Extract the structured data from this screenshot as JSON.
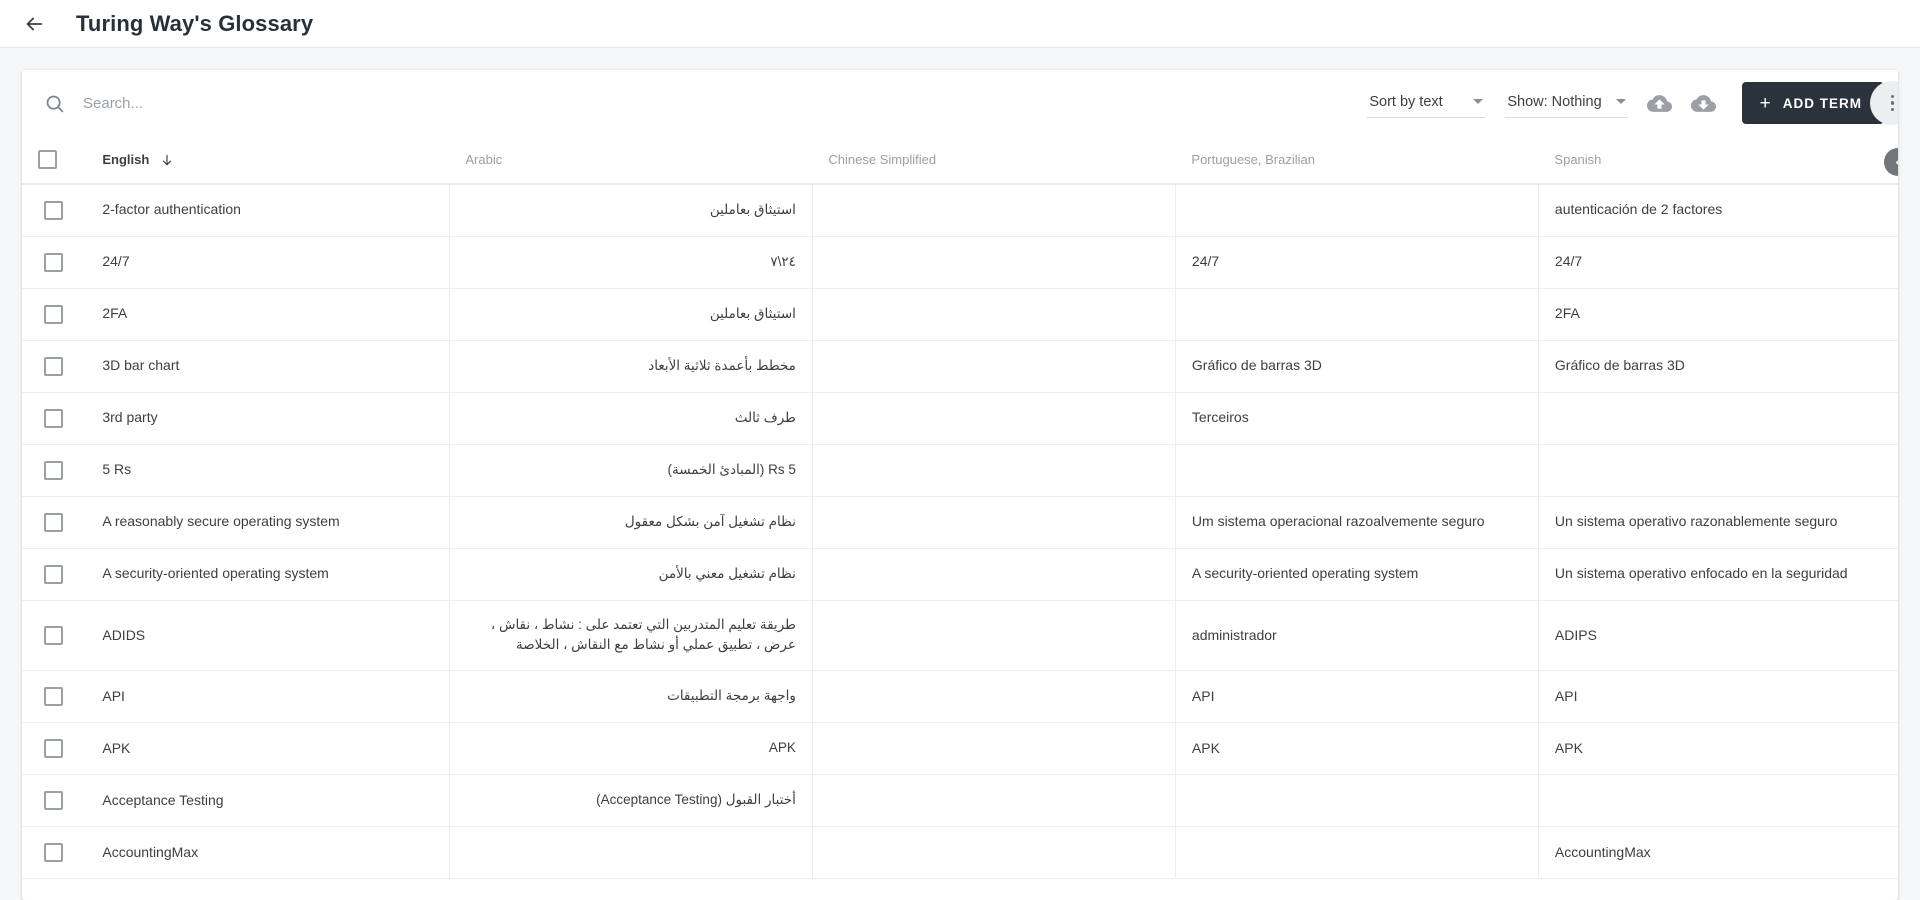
{
  "appbar": {
    "back_icon": "arrow-left-icon",
    "title": "Turing Way's Glossary"
  },
  "toolbar": {
    "search_icon": "search-icon",
    "search_value": "",
    "search_placeholder": "Search...",
    "sort_label": "Sort by text",
    "show_label": "Show: Nothing",
    "upload_icon": "cloud-upload-icon",
    "download_icon": "cloud-download-icon",
    "add_term_label": "ADD TERM",
    "add_term_plus": "+",
    "overflow_icon": "more-vertical-icon",
    "accent_color": "#2a333c"
  },
  "table": {
    "select_all_icon": "checkbox-unchecked-icon",
    "sort_icon": "arrow-down-icon",
    "sorted_column": "English",
    "columns": [
      "English",
      "Arabic",
      "Chinese Simplified",
      "Portuguese, Brazilian",
      "Spanish"
    ],
    "rows": [
      {
        "english": "2-factor authentication",
        "arabic": "استيثاق بعاملين",
        "chinese": "",
        "portuguese": "",
        "spanish": "autenticación de 2 factores"
      },
      {
        "english": "24/7",
        "arabic": "٢٤\\٧",
        "chinese": "",
        "portuguese": "24/7",
        "spanish": "24/7"
      },
      {
        "english": "2FA",
        "arabic": "استيثاق بعاملين",
        "chinese": "",
        "portuguese": "",
        "spanish": "2FA"
      },
      {
        "english": "3D bar chart",
        "arabic": "مخطط بأعمدة ثلاثية الأبعاد",
        "chinese": "",
        "portuguese": "Gráfico de barras 3D",
        "spanish": "Gráfico de barras 3D"
      },
      {
        "english": "3rd party",
        "arabic": "طرف ثالث",
        "chinese": "",
        "portuguese": "Terceiros",
        "spanish": ""
      },
      {
        "english": "5 Rs",
        "arabic": "5 Rs (المبادئ الخمسة)",
        "chinese": "",
        "portuguese": "",
        "spanish": ""
      },
      {
        "english": "A reasonably secure operating system",
        "arabic": "نظام تشغيل آمن بشكل معقول",
        "chinese": "",
        "portuguese": "Um sistema operacional razoalvemente seguro",
        "spanish": "Un sistema operativo razonablemente seguro"
      },
      {
        "english": "A security-oriented operating system",
        "arabic": "نظام تشغيل معني بالأمن",
        "chinese": "",
        "portuguese": "A security-oriented operating system",
        "spanish": "Un sistema operativo enfocado en la seguridad"
      },
      {
        "english": "ADIDS",
        "arabic": "طريقة تعليم المتدربين التي تعتمد على : نشاط ، نقاش ، عرض ، تطبيق عملي أو نشاط مع النقاش ، الخلاصة",
        "chinese": "",
        "portuguese": "administrador",
        "spanish": "ADIPS"
      },
      {
        "english": "API",
        "arabic": "واجهة برمجة التطبيقات",
        "chinese": "",
        "portuguese": "API",
        "spanish": "API"
      },
      {
        "english": "APK",
        "arabic": "APK",
        "chinese": "",
        "portuguese": "APK",
        "spanish": "APK"
      },
      {
        "english": "Acceptance Testing",
        "arabic": "أختبار القبول (Acceptance Testing)",
        "chinese": "",
        "portuguese": "",
        "spanish": ""
      },
      {
        "english": "AccountingMax",
        "arabic": "",
        "chinese": "",
        "portuguese": "",
        "spanish": "AccountingMax"
      }
    ]
  }
}
